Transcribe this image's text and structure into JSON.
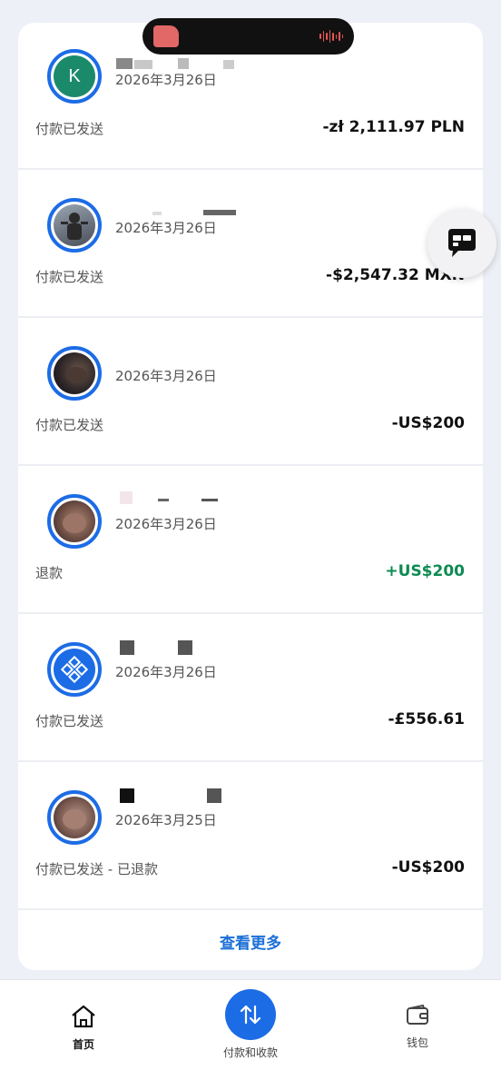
{
  "transactions": [
    {
      "avatar_letter": "K",
      "date": "2026年3月26日",
      "status": "付款已发送",
      "amount": "-zł 2,111.97 PLN",
      "avatar_color": "#1b8a6b"
    },
    {
      "date": "2026年3月26日",
      "status": "付款已发送",
      "amount": "-$2,547.32 MXN"
    },
    {
      "date": "2026年3月26日",
      "status": "付款已发送",
      "amount": "-US$200"
    },
    {
      "date": "2026年3月26日",
      "status": "退款",
      "amount": "+US$200"
    },
    {
      "date": "2026年3月26日",
      "status": "付款已发送",
      "amount": "-£556.61"
    },
    {
      "date": "2026年3月25日",
      "status": "付款已发送 - 已退款",
      "amount": "-US$200"
    }
  ],
  "more_label": "查看更多",
  "nav": {
    "home": "首页",
    "pay": "付款和收款",
    "wallet": "钱包"
  },
  "colors": {
    "accent": "#1c6ce6",
    "positive": "#0d8a52",
    "link": "#1b6fd6"
  }
}
